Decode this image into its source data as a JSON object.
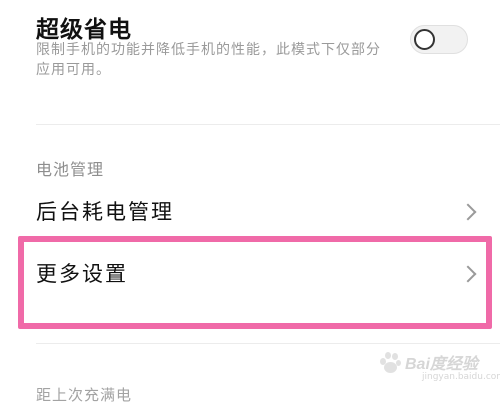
{
  "super_power_saving": {
    "title": "超级省电",
    "description": "限制手机的功能并降低手机的性能，此模式下仅部分应用可用。",
    "enabled": false
  },
  "battery_section": {
    "header": "电池管理",
    "items": [
      {
        "label": "后台耗电管理"
      },
      {
        "label": "更多设置"
      }
    ]
  },
  "since_last_charge": {
    "header": "距上次充满电"
  },
  "watermark": {
    "text": "Bai度经验",
    "sub": "jingyan.baidu.com"
  },
  "colors": {
    "highlight": "#f06aa8",
    "text": "#111111",
    "secondary": "#9a9a9a"
  }
}
